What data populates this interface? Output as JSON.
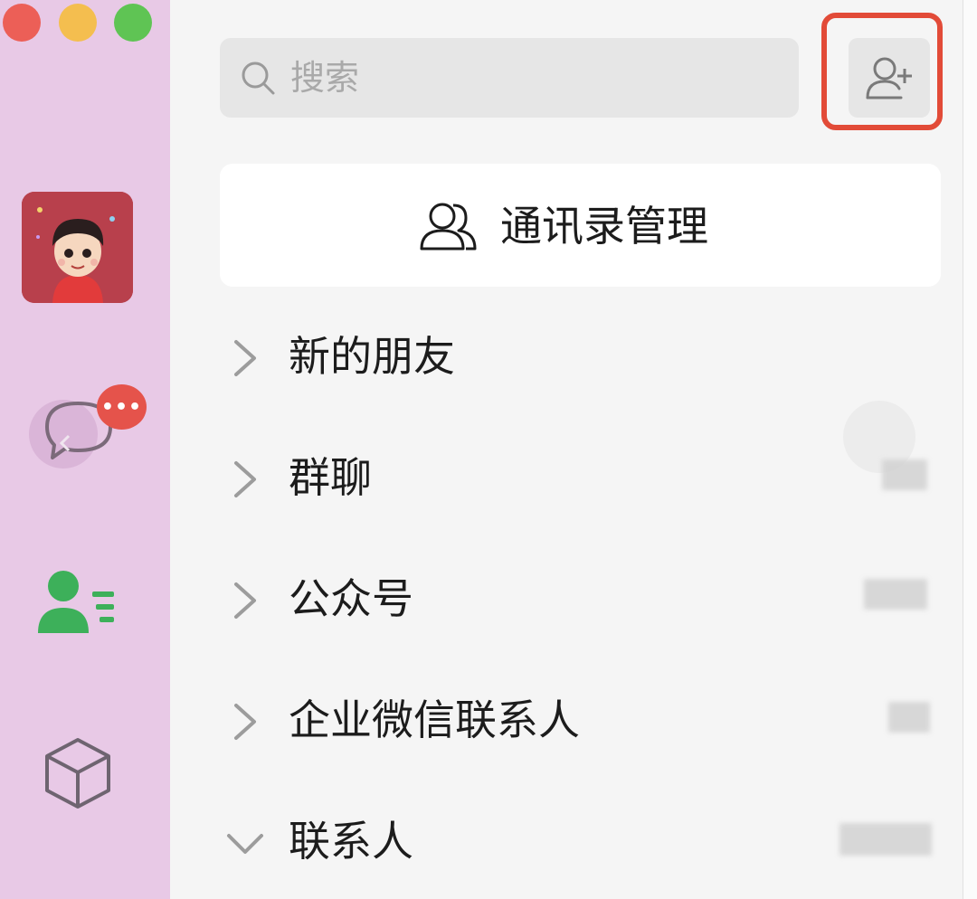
{
  "search": {
    "placeholder": "搜索"
  },
  "toolbar": {
    "add_contact": "add-contact"
  },
  "manage": {
    "label": "通讯录管理"
  },
  "sidebar": {
    "chat_badge": "•••"
  },
  "sections": [
    {
      "label": "新的朋友",
      "expanded": false
    },
    {
      "label": "群聊",
      "expanded": false
    },
    {
      "label": "公众号",
      "expanded": false
    },
    {
      "label": "企业微信联系人",
      "expanded": false
    },
    {
      "label": "联系人",
      "expanded": true
    }
  ],
  "colors": {
    "sidebar_bg": "#e8c9e6",
    "accent_green": "#3db05a",
    "highlight_red": "#e24b38",
    "badge_red": "#e5534b"
  }
}
